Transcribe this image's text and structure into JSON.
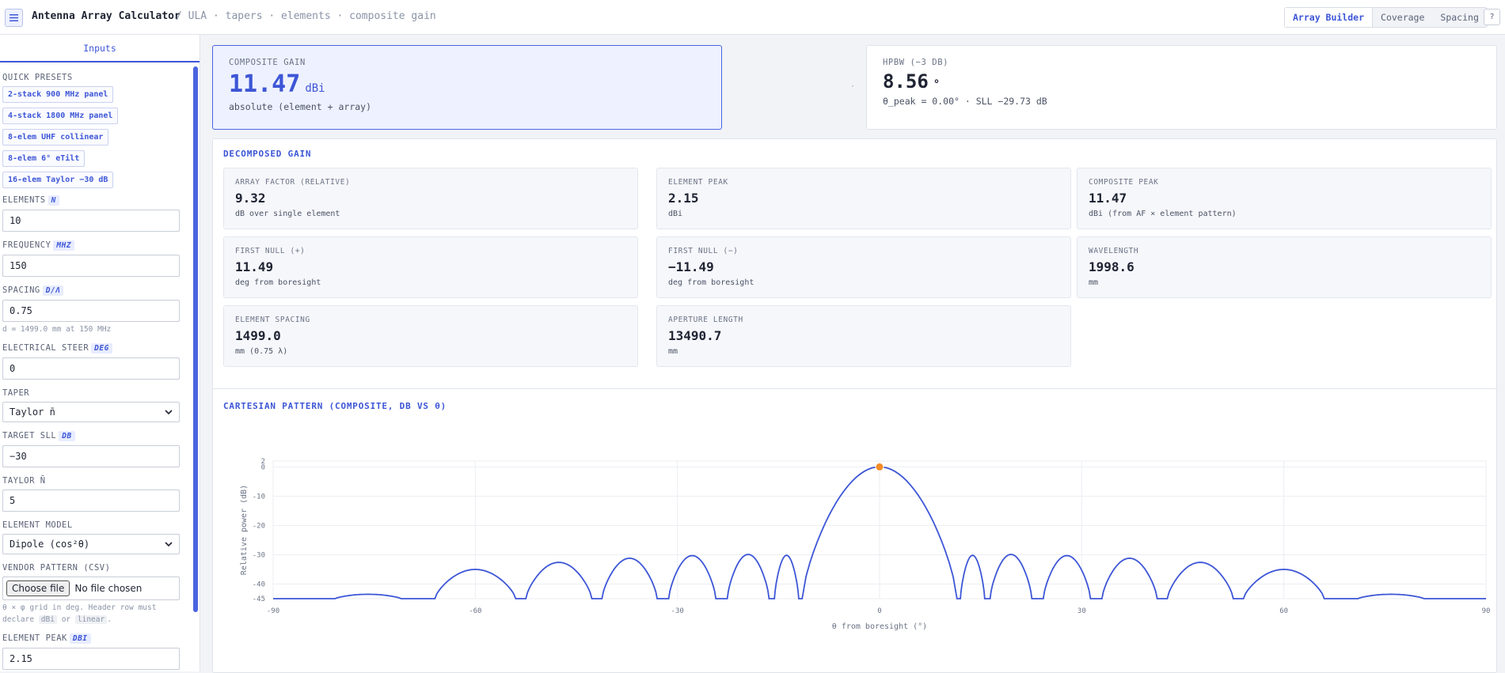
{
  "app": {
    "title": "Antenna Array Calculator",
    "breadcrumb": "/ ULA · tapers · elements · composite gain",
    "menu_icon": "hamburger-icon",
    "help_icon": "question-icon",
    "help_label": "?",
    "tabs": [
      {
        "label": "Array Builder",
        "active": true
      },
      {
        "label": "Coverage",
        "active": false
      },
      {
        "label": "Spacing",
        "active": false
      }
    ]
  },
  "sidebar": {
    "tab": "Inputs",
    "presets_label": "QUICK PRESETS",
    "presets": [
      "2-stack 900 MHz panel",
      "4-stack 1800 MHz panel",
      "8-elem UHF collinear",
      "8-elem 6° eTilt",
      "16-elem Taylor −30 dB"
    ],
    "elements": {
      "label": "ELEMENTS",
      "unit": "N",
      "value": "10"
    },
    "frequency": {
      "label": "FREQUENCY",
      "unit": "MHZ",
      "value": "150"
    },
    "spacing": {
      "label": "SPACING",
      "unit": "D/Λ",
      "value": "0.75",
      "hint": "d = 1499.0 mm at 150 MHz"
    },
    "steer": {
      "label": "ELECTRICAL STEER",
      "unit": "DEG",
      "value": "0"
    },
    "taper": {
      "label": "TAPER",
      "value": "Taylor n̄"
    },
    "target_sll": {
      "label": "TARGET SLL",
      "unit": "DB",
      "value": "−30"
    },
    "taylor_nbar": {
      "label": "TAYLOR N̄",
      "value": "5"
    },
    "element_model": {
      "label": "ELEMENT MODEL",
      "value": "Dipole (cos²θ)"
    },
    "vendor": {
      "label": "VENDOR PATTERN (CSV)",
      "button": "Choose file",
      "status": "No file chosen",
      "hint_a": "θ × φ grid in deg. Header row must declare",
      "code1": "dBi",
      "hint_or": "or",
      "code2": "linear",
      "hint_end": "."
    },
    "element_peak": {
      "label": "ELEMENT PEAK",
      "unit": "DBI",
      "value": "2.15"
    }
  },
  "summary": {
    "composite": {
      "label": "COMPOSITE GAIN",
      "value": "11.47",
      "unit": "dBi",
      "sub": "absolute (element + array)"
    },
    "separator": "·",
    "hpbw": {
      "label": "HPBW (−3 DB)",
      "value": "8.56",
      "unit": "°",
      "sub": "θ_peak = 0.00° · SLL −29.73 dB"
    }
  },
  "decomposed": {
    "title": "DECOMPOSED GAIN",
    "tiles": [
      {
        "label": "ARRAY FACTOR (RELATIVE)",
        "value": "9.32",
        "sub": "dB over single element"
      },
      {
        "label": "ELEMENT PEAK",
        "value": "2.15",
        "sub": "dBi"
      },
      {
        "label": "COMPOSITE PEAK",
        "value": "11.47",
        "sub": "dBi (from AF × element pattern)"
      },
      {
        "label": "FIRST NULL (+)",
        "value": "11.49",
        "sub": "deg from boresight"
      },
      {
        "label": "FIRST NULL (−)",
        "value": "−11.49",
        "sub": "deg from boresight"
      },
      {
        "label": "WAVELENGTH",
        "value": "1998.6",
        "sub": "mm"
      },
      {
        "label": "ELEMENT SPACING",
        "value": "1499.0",
        "sub": "mm (0.75 λ)"
      },
      {
        "label": "APERTURE LENGTH",
        "value": "13490.7",
        "sub": "mm"
      }
    ]
  },
  "chart_data": {
    "type": "line",
    "title": "CARTESIAN PATTERN (COMPOSITE, DB VS θ)",
    "xlabel": "θ from boresight (°)",
    "ylabel": "Relative power (dB)",
    "xlim": [
      -90,
      90
    ],
    "ylim": [
      -45,
      2
    ],
    "xticks": [
      -90,
      -60,
      -30,
      0,
      30,
      60,
      90
    ],
    "yticks": [
      2,
      0,
      -10,
      -20,
      -30,
      -40,
      -45
    ],
    "floor": -45,
    "peak_marker": {
      "x": 0,
      "y": 0,
      "color": "#f28c28"
    },
    "line_color": "#3d56d6",
    "main_lobe": {
      "center": 0,
      "null_minus": -11.49,
      "null_plus": 11.49,
      "peak": 0
    },
    "side_lobes": [
      {
        "center": -75.4,
        "peak": -43.5,
        "left": -80.8,
        "right": -71.0
      },
      {
        "center": -59.8,
        "peak": -35.0,
        "left": -66.0,
        "right": -54.0
      },
      {
        "center": -47.3,
        "peak": -32.6,
        "left": -52.5,
        "right": -42.7
      },
      {
        "center": -37.2,
        "peak": -31.2,
        "left": -41.2,
        "right": -33.0
      },
      {
        "center": -27.8,
        "peak": -30.3,
        "left": -31.3,
        "right": -24.3
      },
      {
        "center": -19.6,
        "peak": -29.9,
        "left": -22.6,
        "right": -16.4
      },
      {
        "center": -14.0,
        "peak": -30.2,
        "left": -15.6,
        "right": -12.0
      },
      {
        "center": 14.0,
        "peak": -30.2,
        "left": 12.0,
        "right": 15.6
      },
      {
        "center": 19.6,
        "peak": -29.9,
        "left": 16.4,
        "right": 22.6
      },
      {
        "center": 27.8,
        "peak": -30.3,
        "left": 24.3,
        "right": 31.3
      },
      {
        "center": 37.2,
        "peak": -31.2,
        "left": 33.0,
        "right": 41.2
      },
      {
        "center": 47.3,
        "peak": -32.6,
        "left": 42.7,
        "right": 52.5
      },
      {
        "center": 59.8,
        "peak": -35.0,
        "left": 54.0,
        "right": 66.0
      },
      {
        "center": 75.4,
        "peak": -43.5,
        "left": 71.0,
        "right": 80.8
      }
    ]
  }
}
